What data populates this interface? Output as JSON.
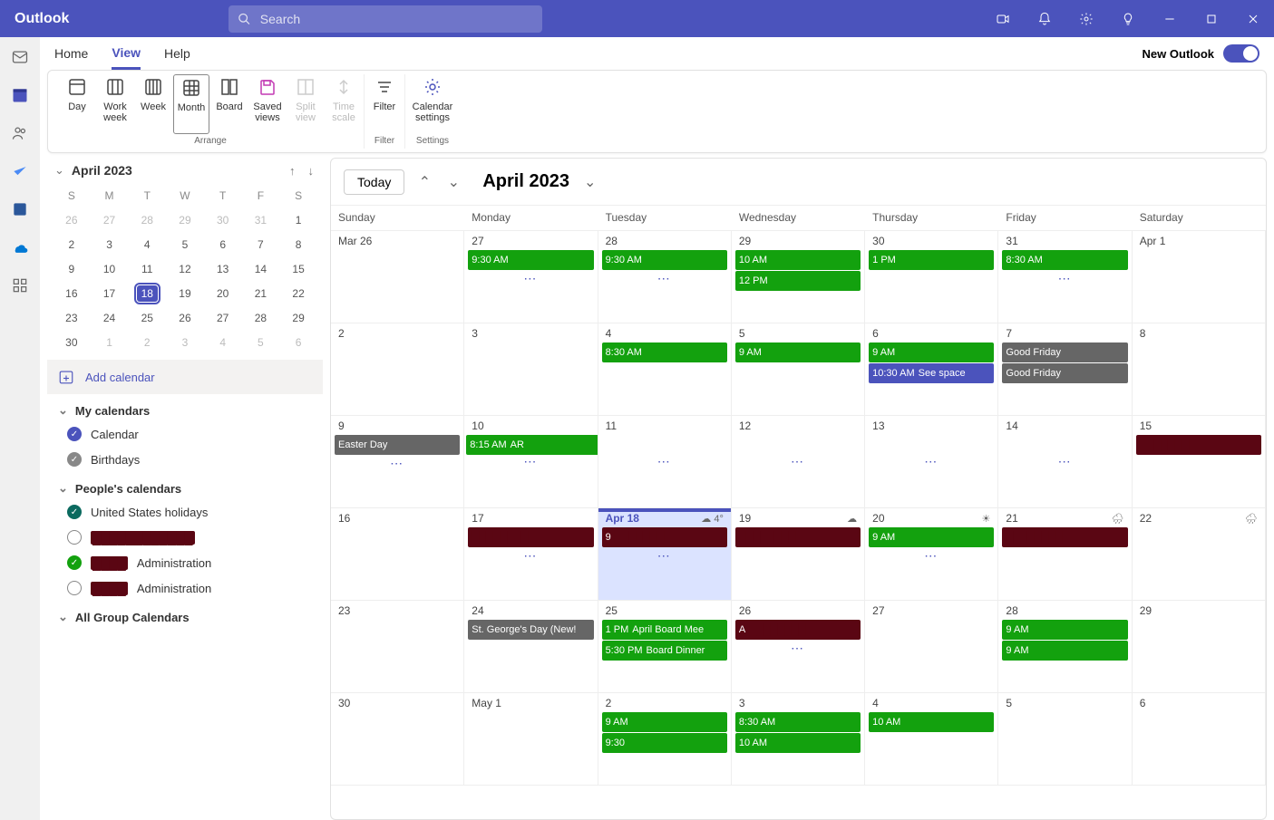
{
  "brand": "Outlook",
  "search_placeholder": "Search",
  "tabs": {
    "home": "Home",
    "view": "View",
    "help": "Help",
    "newOutlook": "New Outlook"
  },
  "ribbon": {
    "day": "Day",
    "workweek": "Work week",
    "week": "Week",
    "month": "Month",
    "board": "Board",
    "saved": "Saved views",
    "split": "Split view",
    "timescale": "Time scale",
    "filter": "Filter",
    "settings": "Calendar settings",
    "g_arrange": "Arrange",
    "g_filter": "Filter",
    "g_settings": "Settings"
  },
  "minical": {
    "title": "April 2023",
    "dow": [
      "S",
      "M",
      "T",
      "W",
      "T",
      "F",
      "S"
    ],
    "rows": [
      [
        {
          "d": "26",
          "o": true
        },
        {
          "d": "27",
          "o": true
        },
        {
          "d": "28",
          "o": true
        },
        {
          "d": "29",
          "o": true
        },
        {
          "d": "30",
          "o": true
        },
        {
          "d": "31",
          "o": true
        },
        {
          "d": "1"
        }
      ],
      [
        {
          "d": "2"
        },
        {
          "d": "3"
        },
        {
          "d": "4"
        },
        {
          "d": "5"
        },
        {
          "d": "6"
        },
        {
          "d": "7"
        },
        {
          "d": "8"
        }
      ],
      [
        {
          "d": "9"
        },
        {
          "d": "10"
        },
        {
          "d": "11"
        },
        {
          "d": "12"
        },
        {
          "d": "13"
        },
        {
          "d": "14"
        },
        {
          "d": "15"
        }
      ],
      [
        {
          "d": "16"
        },
        {
          "d": "17"
        },
        {
          "d": "18",
          "t": true
        },
        {
          "d": "19"
        },
        {
          "d": "20"
        },
        {
          "d": "21"
        },
        {
          "d": "22"
        }
      ],
      [
        {
          "d": "23"
        },
        {
          "d": "24"
        },
        {
          "d": "25"
        },
        {
          "d": "26"
        },
        {
          "d": "27"
        },
        {
          "d": "28"
        },
        {
          "d": "29"
        }
      ],
      [
        {
          "d": "30"
        },
        {
          "d": "1",
          "o": true
        },
        {
          "d": "2",
          "o": true
        },
        {
          "d": "3",
          "o": true
        },
        {
          "d": "4",
          "o": true
        },
        {
          "d": "5",
          "o": true
        },
        {
          "d": "6",
          "o": true
        }
      ]
    ]
  },
  "addCalendar": "Add calendar",
  "groups": {
    "my": "My calendars",
    "people": "People's calendars",
    "allgroup": "All Group Calendars"
  },
  "cals": {
    "calendar": "Calendar",
    "birthdays": "Birthdays",
    "us": "United States holidays",
    "admin1": "Administration",
    "admin2": "Administration"
  },
  "main": {
    "today": "Today",
    "title": "April 2023",
    "dow": [
      "Sunday",
      "Monday",
      "Tuesday",
      "Wednesday",
      "Thursday",
      "Friday",
      "Saturday"
    ],
    "dates": [
      "Mar 26",
      "27",
      "28",
      "29",
      "30",
      "31",
      "Apr 1",
      "2",
      "3",
      "4",
      "5",
      "6",
      "7",
      "8",
      "9",
      "10",
      "11",
      "12",
      "13",
      "14",
      "15",
      "16",
      "17",
      "Apr 18",
      "19",
      "20",
      "21",
      "22",
      "23",
      "24",
      "25",
      "26",
      "27",
      "28",
      "29",
      "30",
      "May 1",
      "2",
      "3",
      "4",
      "5",
      "6"
    ],
    "wx18": "4°"
  },
  "events": {
    "t930": "9:30 AM",
    "t830a": "8:30 AM",
    "t10am": "10 AM",
    "t12pm": "12 PM",
    "t1pm": "1 PM",
    "t830": "8:30 AM",
    "t9am": "9 AM",
    "t1030": "10:30 AM",
    "seespace": "See space",
    "goodfriday": "Good Friday",
    "easter": "Easter Day",
    "t815": "8:15 AM",
    "ar": "AR",
    "stgeorge": "St. George's Day (New!",
    "t1pmboard": "April Board Mee",
    "t530": "5:30 PM",
    "boarddinner": "Board Dinner",
    "t930b": "9:30"
  }
}
